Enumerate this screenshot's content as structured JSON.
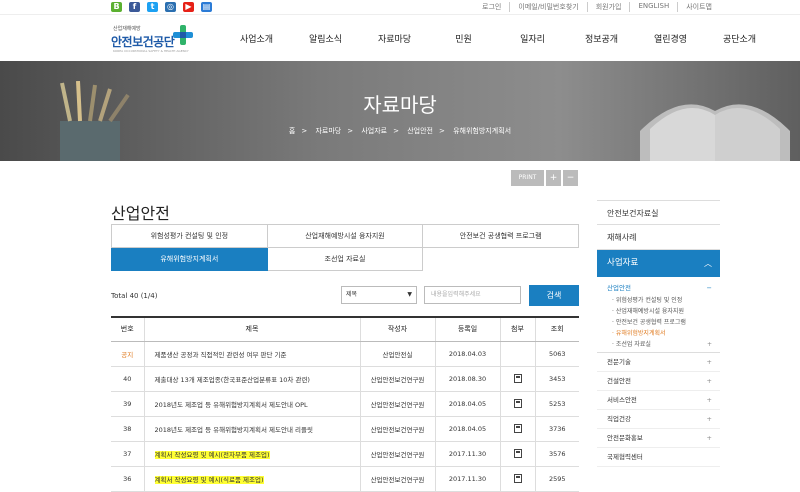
{
  "colors": {
    "accent": "#1a7fc1",
    "notice": "#e07b21",
    "highlight": "#ffff33"
  },
  "utility_links": [
    "로그인",
    "이메일/비밀번호찾기",
    "회원가입",
    "ENGLISH",
    "사이트맵"
  ],
  "social_icons": [
    "blog-icon",
    "facebook-icon",
    "twitter-icon",
    "instagram-icon",
    "youtube-icon",
    "book-icon"
  ],
  "logo": {
    "small": "산업재해예방",
    "name": "안전보건공단",
    "tiny": "KOREA OCCUPATIONAL SAFETY & HEALTH AGENCY"
  },
  "gnb": [
    "사업소개",
    "알림소식",
    "자료마당",
    "민원",
    "일자리",
    "정보공개",
    "열린경영",
    "공단소개"
  ],
  "hero": {
    "title": "자료마당"
  },
  "breadcrumb": [
    "홈",
    "자료마당",
    "사업자료",
    "산업안전",
    "유해위험방지계획서"
  ],
  "tools": {
    "print": "PRINT",
    "plus": "+",
    "minus": "−"
  },
  "page_title": "산업안전",
  "tabs": [
    "위험성평가 컨설팅 및 인정",
    "산업재해예방시설 융자지원",
    "안전보건 공생협력 프로그램",
    "유해위험방지계획서",
    "조선업 자료실"
  ],
  "total": "Total  40 (1/4)",
  "search": {
    "select": "제목",
    "placeholder": "내용을입력해주세요",
    "button": "검색"
  },
  "columns": [
    "번호",
    "제목",
    "작성자",
    "등록일",
    "첨부",
    "조회"
  ],
  "rows": [
    {
      "no": "공지",
      "title": "제품생산 공정과 직접적인 관련성 여부 판단 기준",
      "author": "산업안전실",
      "date": "2018.04.03",
      "file": false,
      "views": "5063"
    },
    {
      "no": "40",
      "title": "제출대상 13개 제조업종(한국표준산업분류표 10차 관련)",
      "author": "산업안전보건연구원",
      "date": "2018.08.30",
      "file": true,
      "views": "3453"
    },
    {
      "no": "39",
      "title": "2018년도 제조업 등 유해위험방지계획서 제도안내 OPL",
      "author": "산업안전보건연구원",
      "date": "2018.04.05",
      "file": true,
      "views": "5253"
    },
    {
      "no": "38",
      "title": "2018년도 제조업 등 유해위험방지계획서 제도안내 리플릿",
      "author": "산업안전보건연구원",
      "date": "2018.04.05",
      "file": true,
      "views": "3736"
    },
    {
      "no": "37",
      "title": "계획서 작성요령 및 예시(전자부품 제조업)",
      "author": "산업안전보건연구원",
      "date": "2017.11.30",
      "file": true,
      "views": "3576"
    },
    {
      "no": "36",
      "title": "계획서 작성요령 및 예시(식료품 제조업)",
      "author": "산업안전보건연구원",
      "date": "2017.11.30",
      "file": true,
      "views": "2595"
    }
  ],
  "sidebar": {
    "items_top": [
      "안전보건자료실",
      "재해사례"
    ],
    "current": "사업자료",
    "group": "산업안전",
    "group_sign": "−",
    "sub": [
      "위험성평가 컨설팅 및 인정",
      "산업재해예방시설 융자지원",
      "안전보건 공생협력 프로그램",
      "유해위험방지계획서",
      "조선업 자료실"
    ],
    "items_bottom": [
      "전문기술",
      "건설안전",
      "서비스안전",
      "직업건강",
      "안전문화홍보",
      "국제협력센터"
    ],
    "plus": "+"
  }
}
